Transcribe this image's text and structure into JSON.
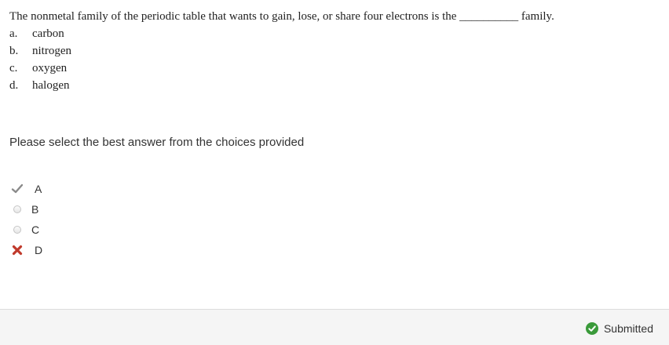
{
  "question": {
    "text": "The nonmetal family of the periodic table that wants to gain, lose, or share four electrons is the __________ family.",
    "options": [
      {
        "letter": "a.",
        "text": "carbon"
      },
      {
        "letter": "b.",
        "text": "nitrogen"
      },
      {
        "letter": "c.",
        "text": "oxygen"
      },
      {
        "letter": "d.",
        "text": "halogen"
      }
    ]
  },
  "instructions": "Please select the best answer from the choices provided",
  "answers": [
    {
      "label": "A",
      "state": "correct-checkmark"
    },
    {
      "label": "B",
      "state": "unselected-radio"
    },
    {
      "label": "C",
      "state": "unselected-radio"
    },
    {
      "label": "D",
      "state": "incorrect-selected-x"
    }
  ],
  "footer": {
    "status_label": "Submitted",
    "status_icon": "check-circle-icon",
    "status_color": "#3a9a3a"
  },
  "colors": {
    "incorrect": "#c0392b",
    "correct_check": "#8a8a8a"
  }
}
